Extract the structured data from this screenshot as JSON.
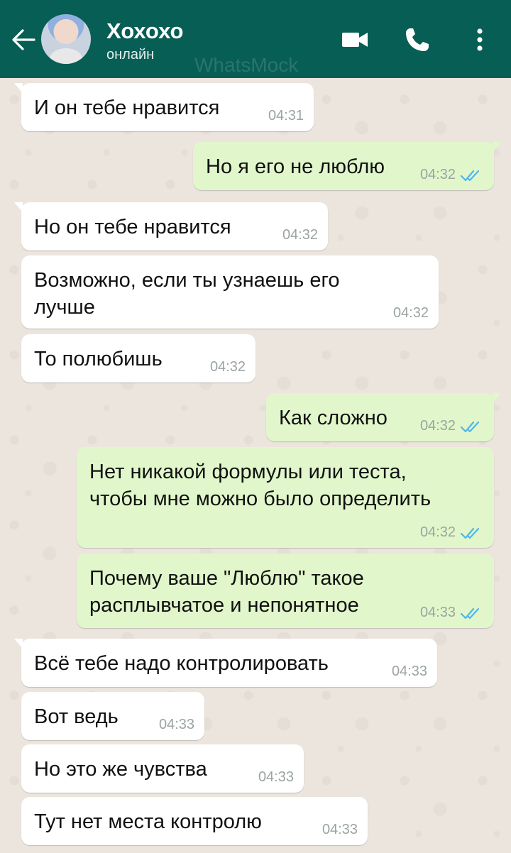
{
  "header": {
    "contact_name": "Хохохо",
    "status": "онлайн",
    "watermark": "WhatsMock",
    "bg_color": "#075e54"
  },
  "colors": {
    "incoming_bubble": "#ffffff",
    "outgoing_bubble": "#e1f7cb",
    "read_ticks": "#4fb6ec",
    "chat_background": "#ece5dd"
  },
  "icons": {
    "back": "arrow-left-icon",
    "video": "video-camera-icon",
    "call": "phone-icon",
    "more": "more-vertical-icon",
    "read": "double-check-icon"
  },
  "messages": [
    {
      "dir": "in",
      "text": "И он тебе нравится",
      "time": "04:31"
    },
    {
      "dir": "out",
      "text": "Но я его не люблю",
      "time": "04:32",
      "read": true
    },
    {
      "dir": "in",
      "text": "Но он тебе нравится",
      "time": "04:32"
    },
    {
      "dir": "in",
      "text": "Возможно, если ты узнаешь его\nлучше",
      "time": "04:32"
    },
    {
      "dir": "in",
      "text": "То полюбишь",
      "time": "04:32"
    },
    {
      "dir": "out",
      "text": "Как сложно",
      "time": "04:32",
      "read": true
    },
    {
      "dir": "out",
      "text": "Нет никакой формулы или теста,\nчтобы мне можно было определить",
      "time": "04:32",
      "read": true
    },
    {
      "dir": "out",
      "text": "Почему ваше \"Люблю\" такое\nрасплывчатое и непонятное",
      "time": "04:33",
      "read": true
    },
    {
      "dir": "in",
      "text": "Всё тебе надо контролировать",
      "time": "04:33"
    },
    {
      "dir": "in",
      "text": "Вот ведь",
      "time": "04:33"
    },
    {
      "dir": "in",
      "text": "Но это же чувства",
      "time": "04:33"
    },
    {
      "dir": "in",
      "text": "Тут нет места контролю",
      "time": "04:33"
    }
  ]
}
